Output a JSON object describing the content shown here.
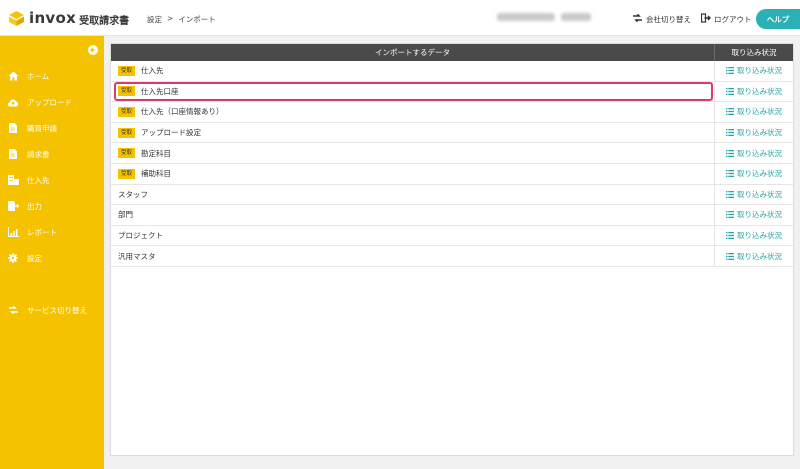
{
  "header": {
    "logo_word": "invox",
    "logo_sub": "受取請求書",
    "breadcrumb": [
      "設定",
      ">",
      "インポート"
    ],
    "switch_company": "会社切り替え",
    "logout": "ログアウト",
    "help": "ヘルプ"
  },
  "sidebar": {
    "items": [
      {
        "label": "ホーム",
        "icon": "home-icon"
      },
      {
        "label": "アップロード",
        "icon": "cloud-upload-icon"
      },
      {
        "label": "購買申請",
        "icon": "document-icon"
      },
      {
        "label": "請求書",
        "icon": "document-icon"
      },
      {
        "label": "仕入先",
        "icon": "building-icon"
      },
      {
        "label": "出力",
        "icon": "export-icon"
      },
      {
        "label": "レポート",
        "icon": "bar-chart-icon"
      },
      {
        "label": "設定",
        "icon": "gear-icon"
      },
      {
        "label": "サービス切り替え",
        "icon": "switch-icon"
      }
    ]
  },
  "table": {
    "header_main": "インポートするデータ",
    "header_status": "取り込み状況",
    "rows": [
      {
        "badge": "受取",
        "label": "仕入先",
        "status": "取り込み状況"
      },
      {
        "badge": "受取",
        "label": "仕入先口座",
        "status": "取り込み状況"
      },
      {
        "badge": "受取",
        "label": "仕入先（口座情報あり）",
        "status": "取り込み状況"
      },
      {
        "badge": "受取",
        "label": "アップロード設定",
        "status": "取り込み状況"
      },
      {
        "badge": "受取",
        "label": "勘定科目",
        "status": "取り込み状況"
      },
      {
        "badge": "受取",
        "label": "補助科目",
        "status": "取り込み状況"
      },
      {
        "badge": "",
        "label": "スタッフ",
        "status": "取り込み状況"
      },
      {
        "badge": "",
        "label": "部門",
        "status": "取り込み状況"
      },
      {
        "badge": "",
        "label": "プロジェクト",
        "status": "取り込み状況"
      },
      {
        "badge": "",
        "label": "汎用マスタ",
        "status": "取り込み状況"
      }
    ],
    "highlighted_row": 1
  },
  "colors": {
    "sidebar": "#f5c200",
    "accent": "#2bb1b5",
    "highlight": "#d63b72",
    "header_bar": "#4a4a4a"
  }
}
